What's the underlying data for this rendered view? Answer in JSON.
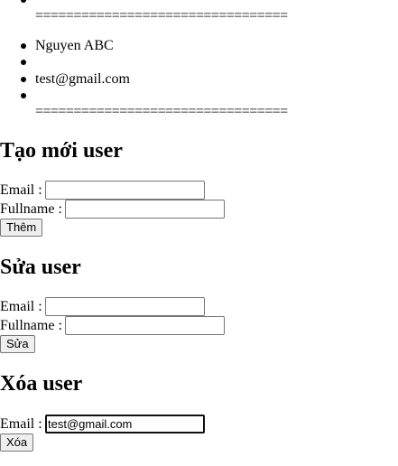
{
  "user_list": {
    "separator_top": "=================================",
    "items": [
      "Nguyen ABC",
      "",
      "test@gmail.com",
      ""
    ],
    "separator_bottom": "================================="
  },
  "create_section": {
    "title": "Tạo mới user",
    "email_label": "Email :",
    "email_value": "",
    "fullname_label": "Fullname :",
    "fullname_value": "",
    "submit_label": "Thêm"
  },
  "edit_section": {
    "title": "Sửa user",
    "email_label": "Email :",
    "email_value": "",
    "fullname_label": "Fullname :",
    "fullname_value": "",
    "submit_label": "Sửa"
  },
  "delete_section": {
    "title": "Xóa user",
    "email_label": "Email :",
    "email_value": "test@gmail.com",
    "submit_label": "Xóa"
  }
}
